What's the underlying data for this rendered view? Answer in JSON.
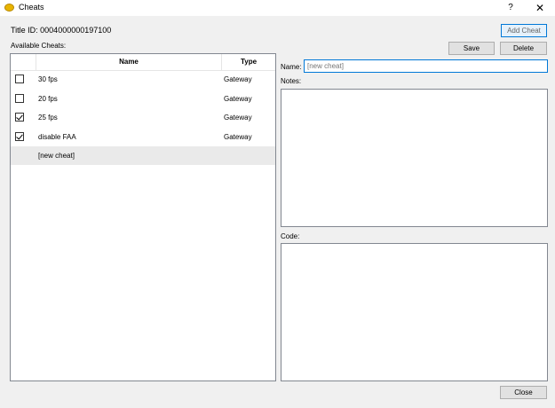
{
  "window": {
    "title": "Cheats",
    "help": "?",
    "close_glyph": "✕"
  },
  "title_id": "Title ID: 0004000000197100",
  "available_label": "Available Cheats:",
  "buttons": {
    "add_cheat": "Add Cheat",
    "save": "Save",
    "delete": "Delete",
    "close": "Close"
  },
  "table": {
    "headers": {
      "name": "Name",
      "type": "Type"
    },
    "rows": [
      {
        "name": "30 fps",
        "type": "Gateway",
        "checked": false
      },
      {
        "name": "20 fps",
        "type": "Gateway",
        "checked": false
      },
      {
        "name": "25 fps",
        "type": "Gateway",
        "checked": true
      },
      {
        "name": "disable FAA",
        "type": "Gateway",
        "checked": true
      },
      {
        "name": "[new cheat]",
        "type": "",
        "checked": null,
        "selected": true
      }
    ]
  },
  "editor": {
    "name_label": "Name:",
    "name_placeholder": "[new cheat]",
    "notes_label": "Notes:",
    "code_label": "Code:"
  },
  "colors": {
    "accent": "#0078d7",
    "selected_row": "#eaeaea",
    "app_icon": "#e8b400"
  },
  "icons": {
    "app": "coin-icon",
    "help": "help-icon",
    "close": "close-icon",
    "checkbox": "checkbox-icon"
  }
}
